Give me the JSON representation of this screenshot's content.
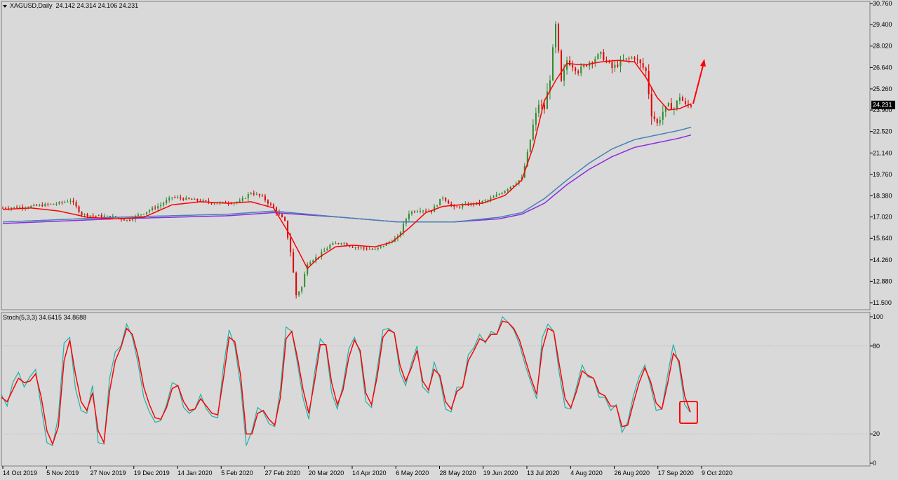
{
  "main_header": {
    "symbol_label": "XAGUSD,Daily",
    "ohlc": "24.142 24.314 24.106 24.231"
  },
  "stoch_header": {
    "label": "Stoch(5,3,3) 34.6415 34.8688"
  },
  "colors": {
    "background": "#d9d9d9",
    "bull": "#2e8b2e",
    "bear": "#e00000",
    "ma_fast": "#ff0000",
    "ma_slow_blue": "#4682b4",
    "ma_slow_purple": "#8a2be2",
    "stoch_main": "#20b2aa",
    "stoch_signal": "#ff0000",
    "annotation": "#ff0000"
  },
  "chart_data": [
    {
      "type": "candlestick",
      "title": "XAGUSD,Daily",
      "last_price": "24.231",
      "ylim": [
        11.5,
        30.76
      ],
      "y_ticks": [
        "30.760",
        "29.400",
        "28.020",
        "26.640",
        "25.260",
        "23.900",
        "22.520",
        "21.140",
        "19.760",
        "18.380",
        "17.020",
        "15.640",
        "14.260",
        "12.880",
        "11.500"
      ],
      "x_ticks": [
        "14 Oct 2019",
        "5 Nov 2019",
        "27 Nov 2019",
        "19 Dec 2019",
        "14 Jan 2020",
        "5 Feb 2020",
        "27 Feb 2020",
        "20 Mar 2020",
        "14 Apr 2020",
        "6 May 2020",
        "28 May 2020",
        "19 Jun 2020",
        "13 Jul 2020",
        "4 Aug 2020",
        "26 Aug 2020",
        "17 Sep 2020",
        "9 Oct 2020"
      ],
      "price_path": [
        [
          0,
          17.6
        ],
        [
          10,
          17.7
        ],
        [
          20,
          17.9
        ],
        [
          24,
          18.1
        ],
        [
          28,
          17.2
        ],
        [
          32,
          17.1
        ],
        [
          40,
          17.0
        ],
        [
          44,
          16.8
        ],
        [
          50,
          17.3
        ],
        [
          56,
          17.8
        ],
        [
          60,
          18.3
        ],
        [
          68,
          18.1
        ],
        [
          76,
          17.9
        ],
        [
          84,
          18.0
        ],
        [
          88,
          18.6
        ],
        [
          92,
          18.3
        ],
        [
          96,
          17.6
        ],
        [
          100,
          16.7
        ],
        [
          102,
          14.8
        ],
        [
          104,
          12.0
        ],
        [
          106,
          12.5
        ],
        [
          108,
          14.1
        ],
        [
          112,
          14.5
        ],
        [
          116,
          15.2
        ],
        [
          120,
          15.4
        ],
        [
          124,
          15.1
        ],
        [
          128,
          15.0
        ],
        [
          132,
          14.9
        ],
        [
          136,
          15.3
        ],
        [
          140,
          15.7
        ],
        [
          144,
          17.3
        ],
        [
          148,
          17.5
        ],
        [
          152,
          17.4
        ],
        [
          156,
          18.3
        ],
        [
          160,
          17.6
        ],
        [
          164,
          17.8
        ],
        [
          168,
          17.9
        ],
        [
          172,
          18.1
        ],
        [
          176,
          18.5
        ],
        [
          180,
          19.0
        ],
        [
          184,
          19.5
        ],
        [
          186,
          21.1
        ],
        [
          188,
          22.9
        ],
        [
          190,
          24.3
        ],
        [
          192,
          24.0
        ],
        [
          194,
          26.0
        ],
        [
          196,
          29.3
        ],
        [
          198,
          25.6
        ],
        [
          200,
          27.1
        ],
        [
          204,
          26.4
        ],
        [
          208,
          27.0
        ],
        [
          212,
          27.5
        ],
        [
          216,
          26.6
        ],
        [
          220,
          27.1
        ],
        [
          224,
          27.3
        ],
        [
          228,
          26.4
        ],
        [
          230,
          23.7
        ],
        [
          232,
          23.0
        ],
        [
          234,
          23.8
        ],
        [
          236,
          24.2
        ],
        [
          238,
          24.0
        ],
        [
          240,
          24.8
        ],
        [
          242,
          24.2
        ],
        [
          244,
          24.231
        ]
      ],
      "ma_fast_path": [
        [
          0,
          17.5
        ],
        [
          10,
          17.6
        ],
        [
          20,
          17.4
        ],
        [
          30,
          17.0
        ],
        [
          40,
          16.9
        ],
        [
          50,
          17.0
        ],
        [
          60,
          17.8
        ],
        [
          70,
          18.0
        ],
        [
          80,
          17.9
        ],
        [
          88,
          18.0
        ],
        [
          96,
          17.6
        ],
        [
          102,
          15.8
        ],
        [
          108,
          13.7
        ],
        [
          112,
          14.4
        ],
        [
          118,
          15.1
        ],
        [
          124,
          15.2
        ],
        [
          132,
          15.1
        ],
        [
          138,
          15.4
        ],
        [
          144,
          16.3
        ],
        [
          150,
          17.3
        ],
        [
          156,
          17.7
        ],
        [
          162,
          17.8
        ],
        [
          170,
          17.9
        ],
        [
          178,
          18.4
        ],
        [
          184,
          19.4
        ],
        [
          188,
          21.5
        ],
        [
          192,
          24.5
        ],
        [
          196,
          25.8
        ],
        [
          200,
          26.9
        ],
        [
          206,
          26.8
        ],
        [
          212,
          27.0
        ],
        [
          218,
          27.1
        ],
        [
          224,
          27.0
        ],
        [
          228,
          26.0
        ],
        [
          232,
          24.7
        ],
        [
          236,
          23.9
        ],
        [
          240,
          24.0
        ],
        [
          244,
          24.3
        ]
      ],
      "ma_slow_blue_path": [
        [
          0,
          16.7
        ],
        [
          40,
          17.0
        ],
        [
          80,
          17.2
        ],
        [
          96,
          17.4
        ],
        [
          120,
          17.0
        ],
        [
          140,
          16.7
        ],
        [
          160,
          16.7
        ],
        [
          176,
          17.0
        ],
        [
          184,
          17.3
        ],
        [
          192,
          18.2
        ],
        [
          200,
          19.4
        ],
        [
          208,
          20.5
        ],
        [
          216,
          21.4
        ],
        [
          224,
          22.0
        ],
        [
          232,
          22.3
        ],
        [
          240,
          22.6
        ],
        [
          244,
          22.8
        ]
      ],
      "ma_slow_purple_path": [
        [
          0,
          16.6
        ],
        [
          40,
          16.9
        ],
        [
          80,
          17.1
        ],
        [
          96,
          17.3
        ],
        [
          120,
          17.0
        ],
        [
          140,
          16.7
        ],
        [
          160,
          16.7
        ],
        [
          176,
          16.9
        ],
        [
          184,
          17.2
        ],
        [
          192,
          17.9
        ],
        [
          200,
          19.1
        ],
        [
          208,
          20.1
        ],
        [
          216,
          20.9
        ],
        [
          224,
          21.5
        ],
        [
          232,
          21.8
        ],
        [
          240,
          22.1
        ],
        [
          244,
          22.3
        ]
      ]
    },
    {
      "type": "line",
      "title": "Stoch(5,3,3) 34.6415 34.8688",
      "ylim": [
        0,
        100
      ],
      "y_ticks": [
        "100",
        "80",
        "20",
        "0"
      ],
      "series": [
        {
          "name": "Stoch(5,3,3) 34.6415",
          "values": [
            47,
            39,
            55,
            62,
            52,
            59,
            64,
            38,
            14,
            12,
            32,
            82,
            86,
            51,
            36,
            34,
            53,
            14,
            13,
            58,
            76,
            80,
            95,
            86,
            68,
            45,
            35,
            28,
            29,
            40,
            55,
            53,
            38,
            34,
            37,
            47,
            37,
            32,
            31,
            66,
            91,
            80,
            53,
            12,
            22,
            38,
            35,
            27,
            25,
            51,
            93,
            90,
            68,
            44,
            30,
            62,
            85,
            80,
            48,
            37,
            53,
            78,
            86,
            75,
            42,
            38,
            64,
            91,
            92,
            89,
            62,
            53,
            68,
            80,
            52,
            48,
            69,
            58,
            37,
            35,
            52,
            52,
            74,
            79,
            88,
            82,
            90,
            88,
            100,
            96,
            91,
            81,
            67,
            55,
            44,
            86,
            95,
            90,
            61,
            38,
            37,
            52,
            67,
            59,
            58,
            45,
            45,
            36,
            40,
            21,
            28,
            46,
            59,
            67,
            53,
            36,
            37,
            60,
            81,
            67,
            40,
            34.64
          ]
        },
        {
          "name": "Stoch(5,3,3) 34.8688",
          "values": [
            45,
            42,
            50,
            58,
            55,
            56,
            61,
            45,
            22,
            13,
            25,
            70,
            84,
            61,
            42,
            36,
            48,
            22,
            14,
            49,
            70,
            79,
            92,
            88,
            73,
            52,
            40,
            31,
            30,
            38,
            51,
            53,
            42,
            36,
            37,
            44,
            39,
            34,
            33,
            58,
            86,
            83,
            60,
            20,
            20,
            34,
            36,
            30,
            26,
            45,
            85,
            90,
            72,
            50,
            34,
            56,
            81,
            81,
            55,
            40,
            50,
            72,
            84,
            77,
            48,
            40,
            59,
            86,
            91,
            89,
            67,
            56,
            65,
            77,
            56,
            50,
            64,
            60,
            42,
            37,
            49,
            52,
            70,
            77,
            85,
            83,
            88,
            88,
            97,
            96,
            92,
            84,
            71,
            58,
            47,
            78,
            92,
            90,
            67,
            44,
            38,
            49,
            63,
            60,
            58,
            48,
            46,
            39,
            39,
            25,
            26,
            41,
            55,
            65,
            56,
            41,
            37,
            54,
            75,
            70,
            46,
            34.87
          ]
        }
      ],
      "annotation": "box"
    }
  ]
}
